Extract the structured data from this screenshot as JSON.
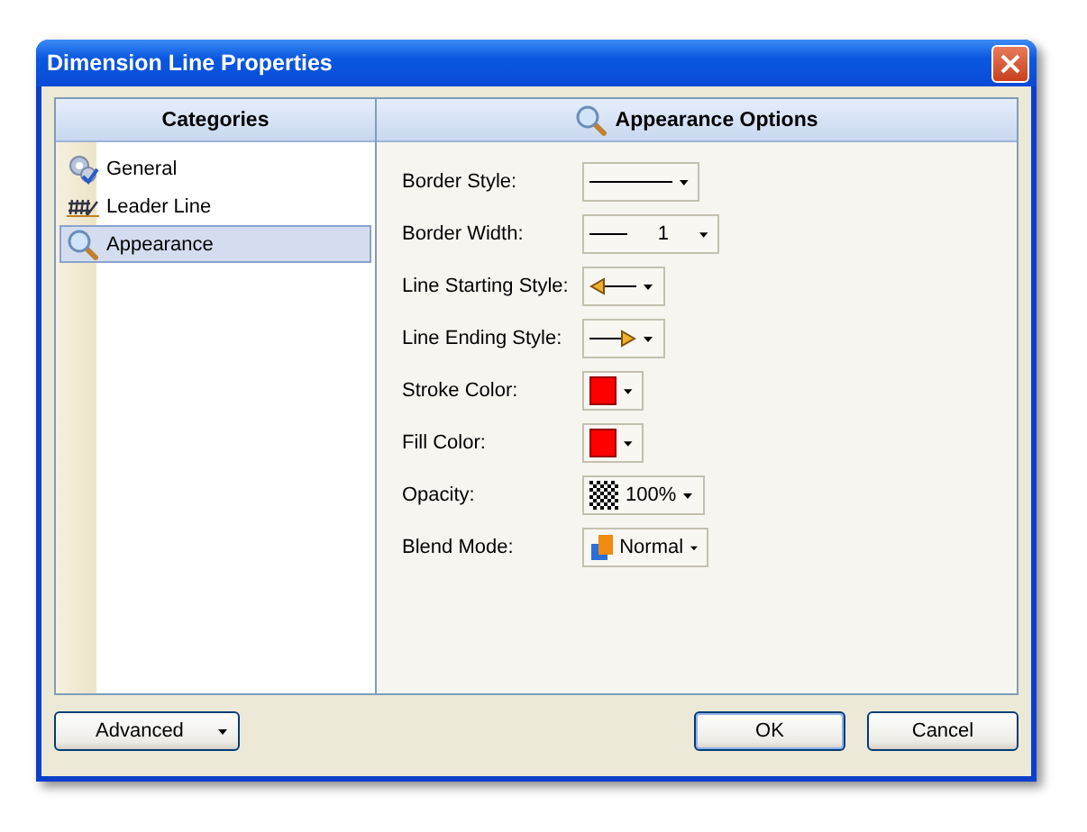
{
  "window": {
    "title": "Dimension Line Properties"
  },
  "categories": {
    "header": "Categories",
    "items": [
      {
        "label": "General",
        "kind": "gears",
        "selected": false
      },
      {
        "label": "Leader Line",
        "kind": "hash",
        "selected": false
      },
      {
        "label": "Appearance",
        "kind": "magnifier",
        "selected": true
      }
    ]
  },
  "options": {
    "header": "Appearance Options",
    "fields": [
      {
        "label": "Border Style:",
        "kind": "line"
      },
      {
        "label": "Border Width:",
        "kind": "width",
        "value": "1"
      },
      {
        "label": "Line Starting Style:",
        "kind": "start-arrow"
      },
      {
        "label": "Line Ending Style:",
        "kind": "end-arrow"
      },
      {
        "label": "Stroke Color:",
        "kind": "color",
        "color": "#ff0000"
      },
      {
        "label": "Fill Color:",
        "kind": "color",
        "color": "#ff0000"
      },
      {
        "label": "Opacity:",
        "kind": "opacity",
        "value": "100%"
      },
      {
        "label": "Blend Mode:",
        "kind": "blend",
        "value": "Normal"
      }
    ]
  },
  "buttons": {
    "advanced": "Advanced",
    "ok": "OK",
    "cancel": "Cancel"
  }
}
